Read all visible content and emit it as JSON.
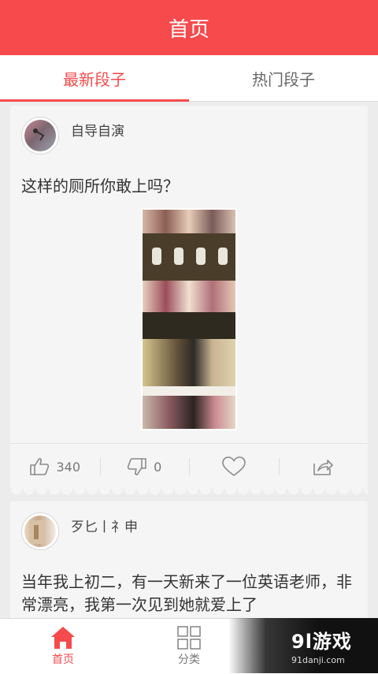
{
  "header": {
    "title": "首页"
  },
  "tabs": [
    {
      "label": "最新段子",
      "active": true
    },
    {
      "label": "热门段子",
      "active": false
    }
  ],
  "posts": [
    {
      "author": "自导自演",
      "text": "这样的厕所你敢上吗？",
      "image_desc": "toilet-photo",
      "likes": "340",
      "dislikes": "0"
    },
    {
      "author": "歹匕丨礻申",
      "text": "当年我上初二，有一天新来了一位英语老师，非常漂亮，我第一次见到她就爱上了"
    }
  ],
  "bottom_nav": [
    {
      "label": "首页",
      "icon": "home-icon",
      "active": true
    },
    {
      "label": "分类",
      "icon": "grid-icon",
      "active": false
    }
  ],
  "watermark": {
    "logo": "9l游戏",
    "url": "91danji.com"
  },
  "colors": {
    "accent": "#f64a4c",
    "background": "#ececec",
    "card": "#f5f5f5"
  }
}
